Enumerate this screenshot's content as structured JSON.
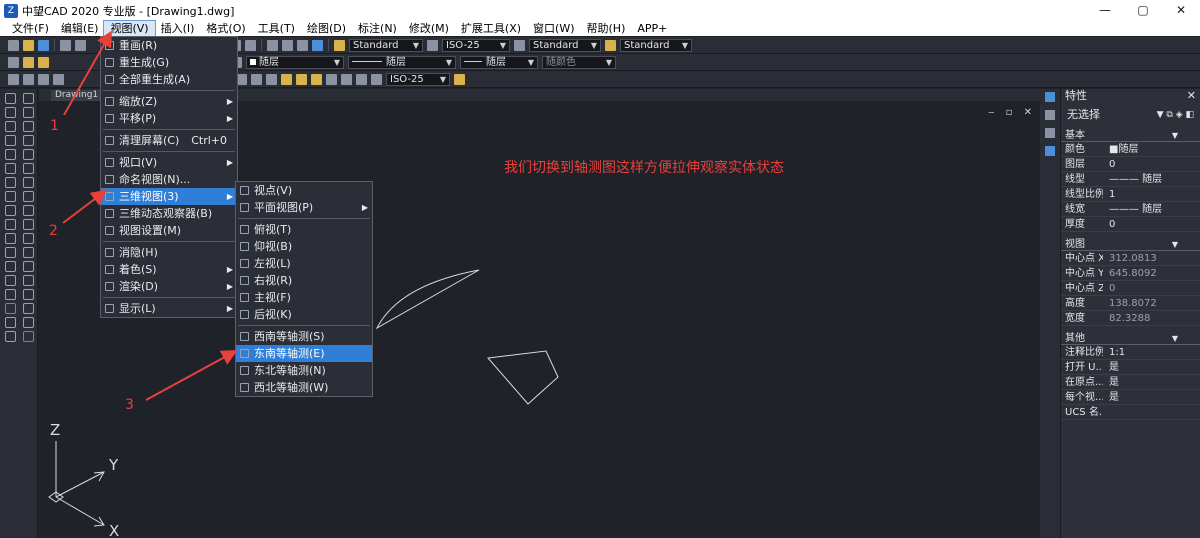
{
  "window": {
    "title": "中望CAD 2020 专业版 - [Drawing1.dwg]",
    "controls": [
      "—",
      "▢",
      "✕"
    ]
  },
  "menubar": [
    {
      "label": "文件(F)"
    },
    {
      "label": "编辑(E)"
    },
    {
      "label": "视图(V)",
      "active": true
    },
    {
      "label": "插入(I)"
    },
    {
      "label": "格式(O)"
    },
    {
      "label": "工具(T)"
    },
    {
      "label": "绘图(D)"
    },
    {
      "label": "标注(N)"
    },
    {
      "label": "修改(M)"
    },
    {
      "label": "扩展工具(X)"
    },
    {
      "label": "窗口(W)"
    },
    {
      "label": "帮助(H)"
    },
    {
      "label": "APP+"
    }
  ],
  "toolbar": {
    "text_style": "Standard",
    "dim_style": "ISO-25",
    "table_style": "Standard",
    "multileader_style": "Standard",
    "layer": "随层",
    "linetype": "随层",
    "lineweight": "随层",
    "color": "随颜色",
    "dim_style2": "ISO-25"
  },
  "doc_tab": "Drawing1",
  "view_menu": [
    {
      "label": "重画(R)"
    },
    {
      "label": "重生成(G)"
    },
    {
      "label": "全部重生成(A)"
    },
    {
      "sep": true
    },
    {
      "label": "缩放(Z)",
      "sub": true
    },
    {
      "label": "平移(P)",
      "sub": true
    },
    {
      "sep": true
    },
    {
      "label": "清理屏幕(C)",
      "shortcut": "Ctrl+0"
    },
    {
      "sep": true
    },
    {
      "label": "视口(V)",
      "sub": true
    },
    {
      "label": "命名视图(N)..."
    },
    {
      "label": "三维视图(3)",
      "sub": true,
      "highlight": true
    },
    {
      "label": "三维动态观察器(B)"
    },
    {
      "label": "视图设置(M)"
    },
    {
      "sep": true
    },
    {
      "label": "消隐(H)"
    },
    {
      "label": "着色(S)",
      "sub": true
    },
    {
      "label": "渲染(D)",
      "sub": true
    },
    {
      "sep": true
    },
    {
      "label": "显示(L)",
      "sub": true
    }
  ],
  "view3d_menu": [
    {
      "label": "视点(V)"
    },
    {
      "label": "平面视图(P)",
      "sub": true
    },
    {
      "sep": true
    },
    {
      "label": "俯视(T)"
    },
    {
      "label": "仰视(B)"
    },
    {
      "label": "左视(L)"
    },
    {
      "label": "右视(R)"
    },
    {
      "label": "主视(F)"
    },
    {
      "label": "后视(K)"
    },
    {
      "sep": true
    },
    {
      "label": "西南等轴测(S)"
    },
    {
      "label": "东南等轴测(E)",
      "highlight": true
    },
    {
      "label": "东北等轴测(N)"
    },
    {
      "label": "西北等轴测(W)"
    }
  ],
  "annotation_text": "我们切换到轴测图这样方便拉伸观察实体状态",
  "step_labels": [
    "1",
    "2",
    "3"
  ],
  "ucs_axes": {
    "z": "Z",
    "y": "Y",
    "x": "X"
  },
  "properties": {
    "title": "特性",
    "close": "✕",
    "selection": "无选择",
    "sections": [
      {
        "title": "基本",
        "rows": [
          {
            "k": "颜色",
            "v": "■随层"
          },
          {
            "k": "图层",
            "v": "0"
          },
          {
            "k": "线型",
            "v": "——— 随层"
          },
          {
            "k": "线型比例",
            "v": "1"
          },
          {
            "k": "线宽",
            "v": "——— 随层"
          },
          {
            "k": "厚度",
            "v": "0"
          }
        ]
      },
      {
        "title": "视图",
        "rows": [
          {
            "k": "中心点 X",
            "v": "312.0813",
            "dim": true
          },
          {
            "k": "中心点 Y",
            "v": "645.8092",
            "dim": true
          },
          {
            "k": "中心点 Z",
            "v": "0",
            "dim": true
          },
          {
            "k": "高度",
            "v": "138.8072",
            "dim": true
          },
          {
            "k": "宽度",
            "v": "82.3288",
            "dim": true
          }
        ]
      },
      {
        "title": "其他",
        "rows": [
          {
            "k": "注释比例",
            "v": "1:1"
          },
          {
            "k": "打开 U...",
            "v": "是"
          },
          {
            "k": "在原点...",
            "v": "是"
          },
          {
            "k": "每个视...",
            "v": "是"
          },
          {
            "k": "UCS 名...",
            "v": ""
          }
        ]
      }
    ]
  },
  "colors": {
    "highlight": "#2f7ed8",
    "annotation": "#e8403a",
    "canvas": "#1f2229"
  }
}
